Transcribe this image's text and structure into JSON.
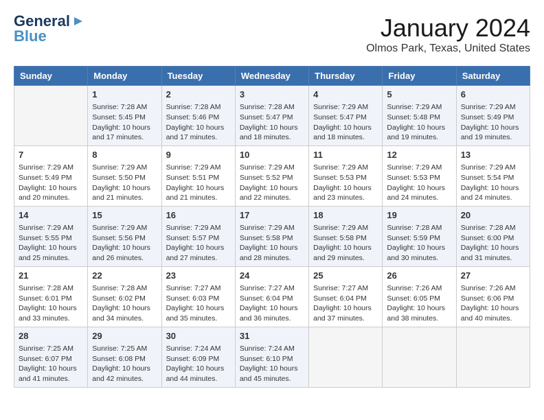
{
  "header": {
    "logo_line1": "General",
    "logo_line2": "Blue",
    "title": "January 2024",
    "subtitle": "Olmos Park, Texas, United States"
  },
  "days_of_week": [
    "Sunday",
    "Monday",
    "Tuesday",
    "Wednesday",
    "Thursday",
    "Friday",
    "Saturday"
  ],
  "weeks": [
    [
      {
        "day": "",
        "info": ""
      },
      {
        "day": "1",
        "info": "Sunrise: 7:28 AM\nSunset: 5:45 PM\nDaylight: 10 hours\nand 17 minutes."
      },
      {
        "day": "2",
        "info": "Sunrise: 7:28 AM\nSunset: 5:46 PM\nDaylight: 10 hours\nand 17 minutes."
      },
      {
        "day": "3",
        "info": "Sunrise: 7:28 AM\nSunset: 5:47 PM\nDaylight: 10 hours\nand 18 minutes."
      },
      {
        "day": "4",
        "info": "Sunrise: 7:29 AM\nSunset: 5:47 PM\nDaylight: 10 hours\nand 18 minutes."
      },
      {
        "day": "5",
        "info": "Sunrise: 7:29 AM\nSunset: 5:48 PM\nDaylight: 10 hours\nand 19 minutes."
      },
      {
        "day": "6",
        "info": "Sunrise: 7:29 AM\nSunset: 5:49 PM\nDaylight: 10 hours\nand 19 minutes."
      }
    ],
    [
      {
        "day": "7",
        "info": "Sunrise: 7:29 AM\nSunset: 5:49 PM\nDaylight: 10 hours\nand 20 minutes."
      },
      {
        "day": "8",
        "info": "Sunrise: 7:29 AM\nSunset: 5:50 PM\nDaylight: 10 hours\nand 21 minutes."
      },
      {
        "day": "9",
        "info": "Sunrise: 7:29 AM\nSunset: 5:51 PM\nDaylight: 10 hours\nand 21 minutes."
      },
      {
        "day": "10",
        "info": "Sunrise: 7:29 AM\nSunset: 5:52 PM\nDaylight: 10 hours\nand 22 minutes."
      },
      {
        "day": "11",
        "info": "Sunrise: 7:29 AM\nSunset: 5:53 PM\nDaylight: 10 hours\nand 23 minutes."
      },
      {
        "day": "12",
        "info": "Sunrise: 7:29 AM\nSunset: 5:53 PM\nDaylight: 10 hours\nand 24 minutes."
      },
      {
        "day": "13",
        "info": "Sunrise: 7:29 AM\nSunset: 5:54 PM\nDaylight: 10 hours\nand 24 minutes."
      }
    ],
    [
      {
        "day": "14",
        "info": "Sunrise: 7:29 AM\nSunset: 5:55 PM\nDaylight: 10 hours\nand 25 minutes."
      },
      {
        "day": "15",
        "info": "Sunrise: 7:29 AM\nSunset: 5:56 PM\nDaylight: 10 hours\nand 26 minutes."
      },
      {
        "day": "16",
        "info": "Sunrise: 7:29 AM\nSunset: 5:57 PM\nDaylight: 10 hours\nand 27 minutes."
      },
      {
        "day": "17",
        "info": "Sunrise: 7:29 AM\nSunset: 5:58 PM\nDaylight: 10 hours\nand 28 minutes."
      },
      {
        "day": "18",
        "info": "Sunrise: 7:29 AM\nSunset: 5:58 PM\nDaylight: 10 hours\nand 29 minutes."
      },
      {
        "day": "19",
        "info": "Sunrise: 7:28 AM\nSunset: 5:59 PM\nDaylight: 10 hours\nand 30 minutes."
      },
      {
        "day": "20",
        "info": "Sunrise: 7:28 AM\nSunset: 6:00 PM\nDaylight: 10 hours\nand 31 minutes."
      }
    ],
    [
      {
        "day": "21",
        "info": "Sunrise: 7:28 AM\nSunset: 6:01 PM\nDaylight: 10 hours\nand 33 minutes."
      },
      {
        "day": "22",
        "info": "Sunrise: 7:28 AM\nSunset: 6:02 PM\nDaylight: 10 hours\nand 34 minutes."
      },
      {
        "day": "23",
        "info": "Sunrise: 7:27 AM\nSunset: 6:03 PM\nDaylight: 10 hours\nand 35 minutes."
      },
      {
        "day": "24",
        "info": "Sunrise: 7:27 AM\nSunset: 6:04 PM\nDaylight: 10 hours\nand 36 minutes."
      },
      {
        "day": "25",
        "info": "Sunrise: 7:27 AM\nSunset: 6:04 PM\nDaylight: 10 hours\nand 37 minutes."
      },
      {
        "day": "26",
        "info": "Sunrise: 7:26 AM\nSunset: 6:05 PM\nDaylight: 10 hours\nand 38 minutes."
      },
      {
        "day": "27",
        "info": "Sunrise: 7:26 AM\nSunset: 6:06 PM\nDaylight: 10 hours\nand 40 minutes."
      }
    ],
    [
      {
        "day": "28",
        "info": "Sunrise: 7:25 AM\nSunset: 6:07 PM\nDaylight: 10 hours\nand 41 minutes."
      },
      {
        "day": "29",
        "info": "Sunrise: 7:25 AM\nSunset: 6:08 PM\nDaylight: 10 hours\nand 42 minutes."
      },
      {
        "day": "30",
        "info": "Sunrise: 7:24 AM\nSunset: 6:09 PM\nDaylight: 10 hours\nand 44 minutes."
      },
      {
        "day": "31",
        "info": "Sunrise: 7:24 AM\nSunset: 6:10 PM\nDaylight: 10 hours\nand 45 minutes."
      },
      {
        "day": "",
        "info": ""
      },
      {
        "day": "",
        "info": ""
      },
      {
        "day": "",
        "info": ""
      }
    ]
  ]
}
